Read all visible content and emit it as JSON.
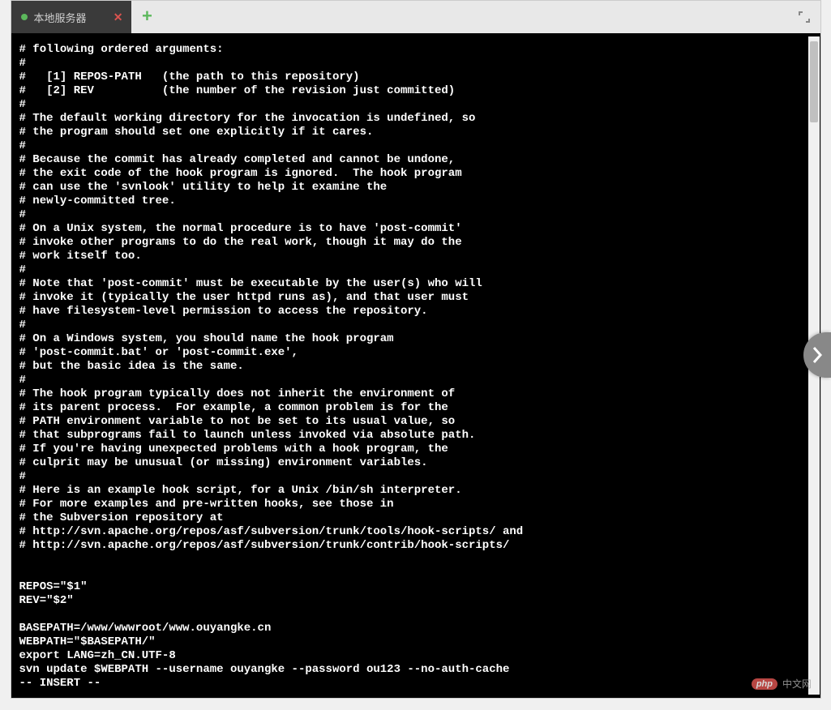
{
  "tab": {
    "title": "本地服务器",
    "close_glyph": "✕"
  },
  "add_tab_glyph": "+",
  "terminal_lines": [
    "# following ordered arguments:",
    "#",
    "#   [1] REPOS-PATH   (the path to this repository)",
    "#   [2] REV          (the number of the revision just committed)",
    "#",
    "# The default working directory for the invocation is undefined, so",
    "# the program should set one explicitly if it cares.",
    "#",
    "# Because the commit has already completed and cannot be undone,",
    "# the exit code of the hook program is ignored.  The hook program",
    "# can use the 'svnlook' utility to help it examine the",
    "# newly-committed tree.",
    "#",
    "# On a Unix system, the normal procedure is to have 'post-commit'",
    "# invoke other programs to do the real work, though it may do the",
    "# work itself too.",
    "#",
    "# Note that 'post-commit' must be executable by the user(s) who will",
    "# invoke it (typically the user httpd runs as), and that user must",
    "# have filesystem-level permission to access the repository.",
    "#",
    "# On a Windows system, you should name the hook program",
    "# 'post-commit.bat' or 'post-commit.exe',",
    "# but the basic idea is the same.",
    "#",
    "# The hook program typically does not inherit the environment of",
    "# its parent process.  For example, a common problem is for the",
    "# PATH environment variable to not be set to its usual value, so",
    "# that subprograms fail to launch unless invoked via absolute path.",
    "# If you're having unexpected problems with a hook program, the",
    "# culprit may be unusual (or missing) environment variables.",
    "#",
    "# Here is an example hook script, for a Unix /bin/sh interpreter.",
    "# For more examples and pre-written hooks, see those in",
    "# the Subversion repository at",
    "# http://svn.apache.org/repos/asf/subversion/trunk/tools/hook-scripts/ and",
    "# http://svn.apache.org/repos/asf/subversion/trunk/contrib/hook-scripts/",
    "",
    "",
    "REPOS=\"$1\"",
    "REV=\"$2\"",
    "",
    "BASEPATH=/www/wwwroot/www.ouyangke.cn",
    "WEBPATH=\"$BASEPATH/\"",
    "export LANG=zh_CN.UTF-8",
    "svn update $WEBPATH --username ouyangke --password ou123 --no-auth-cache"
  ],
  "mode_line": "-- INSERT --",
  "watermark": {
    "badge": "php",
    "text": "中文网"
  }
}
